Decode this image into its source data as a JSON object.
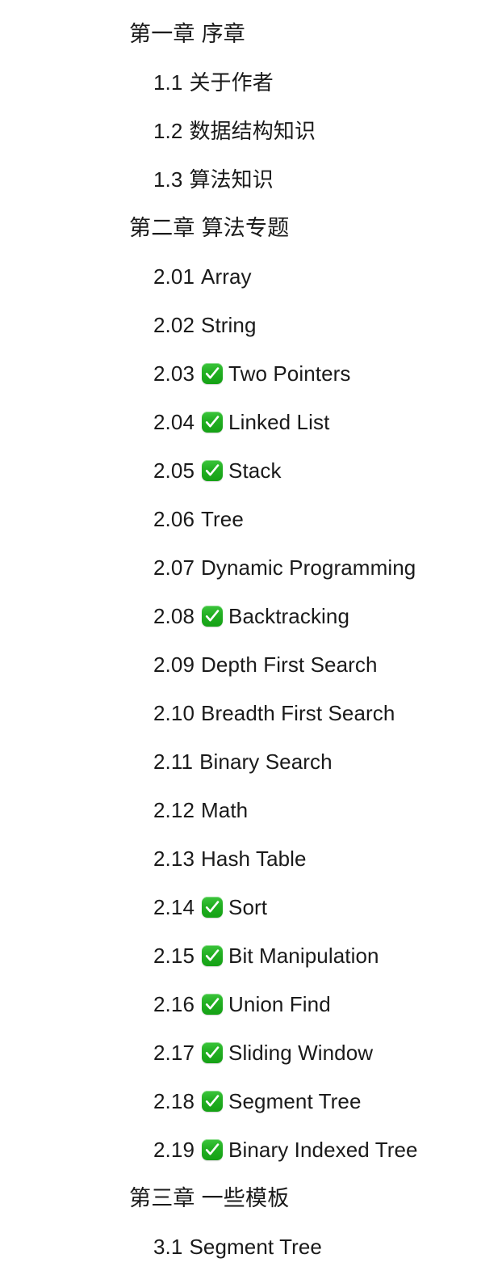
{
  "document": {
    "background_color": "#ffffff",
    "text_color": "#1a1a1a",
    "check_badge_color": "#22b022",
    "check_glyph_color": "#ffffff",
    "check_icon_name": "white-check-mark"
  },
  "toc": {
    "entries": [
      {
        "level": "chapter",
        "number": "第一章",
        "label": "序章",
        "done": false
      },
      {
        "level": "section",
        "number": "1.1",
        "label": "关于作者",
        "done": false
      },
      {
        "level": "section",
        "number": "1.2",
        "label": "数据结构知识",
        "done": false
      },
      {
        "level": "section",
        "number": "1.3",
        "label": "算法知识",
        "done": false
      },
      {
        "level": "chapter",
        "number": "第二章",
        "label": "算法专题",
        "done": false
      },
      {
        "level": "section",
        "number": "2.01",
        "label": "Array",
        "done": false
      },
      {
        "level": "section",
        "number": "2.02",
        "label": "String",
        "done": false
      },
      {
        "level": "section",
        "number": "2.03",
        "label": "Two Pointers",
        "done": true
      },
      {
        "level": "section",
        "number": "2.04",
        "label": "Linked List",
        "done": true
      },
      {
        "level": "section",
        "number": "2.05",
        "label": "Stack",
        "done": true
      },
      {
        "level": "section",
        "number": "2.06",
        "label": "Tree",
        "done": false
      },
      {
        "level": "section",
        "number": "2.07",
        "label": "Dynamic Programming",
        "done": false
      },
      {
        "level": "section",
        "number": "2.08",
        "label": "Backtracking",
        "done": true
      },
      {
        "level": "section",
        "number": "2.09",
        "label": "Depth First Search",
        "done": false
      },
      {
        "level": "section",
        "number": "2.10",
        "label": "Breadth First Search",
        "done": false
      },
      {
        "level": "section",
        "number": "2.11",
        "label": "Binary Search",
        "done": false
      },
      {
        "level": "section",
        "number": "2.12",
        "label": "Math",
        "done": false
      },
      {
        "level": "section",
        "number": "2.13",
        "label": "Hash Table",
        "done": false
      },
      {
        "level": "section",
        "number": "2.14",
        "label": "Sort",
        "done": true
      },
      {
        "level": "section",
        "number": "2.15",
        "label": "Bit Manipulation",
        "done": true
      },
      {
        "level": "section",
        "number": "2.16",
        "label": "Union Find",
        "done": true
      },
      {
        "level": "section",
        "number": "2.17",
        "label": "Sliding Window",
        "done": true
      },
      {
        "level": "section",
        "number": "2.18",
        "label": "Segment Tree",
        "done": true
      },
      {
        "level": "section",
        "number": "2.19",
        "label": "Binary Indexed Tree",
        "done": true
      },
      {
        "level": "chapter",
        "number": "第三章",
        "label": "一些模板",
        "done": false
      },
      {
        "level": "section",
        "number": "3.1",
        "label": "Segment Tree",
        "done": false
      }
    ]
  }
}
